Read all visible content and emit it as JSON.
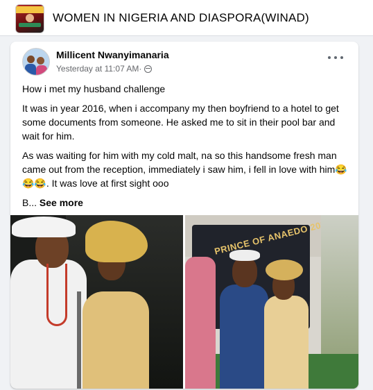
{
  "group": {
    "title": "WOMEN IN NIGERIA AND DIASPORA(WINAD)",
    "logo_icon": "group-logo"
  },
  "post": {
    "author": "Millicent Nwanyimanaria",
    "timestamp": "Yesterday at 11:07 AM",
    "separator": " · ",
    "privacy_icon": "globe-icon",
    "more_icon": "more-options-icon",
    "paragraphs": [
      "How i met my husband challenge",
      "It was in year 2016, when i accompany my then boyfriend to a hotel to get some documents from someone. He asked me to sit in their pool bar and wait for him.",
      "As was waiting for him with my cold malt, na so this handsome fresh man came out from the reception, immediately i saw him, i fell in love with him😂😂😂. It was love at first sight ooo"
    ],
    "truncated_prefix": "B... ",
    "see_more_label": "See more",
    "photo_right_banner_text": "PRINCE OF ANAEDO 2020"
  }
}
